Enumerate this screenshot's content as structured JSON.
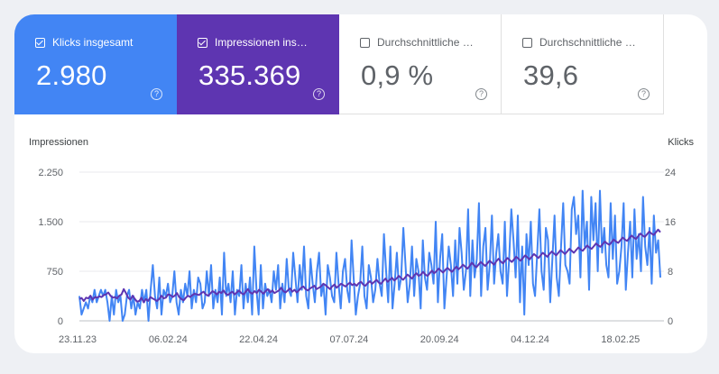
{
  "metrics": [
    {
      "label": "Klicks insgesamt",
      "value": "2.980",
      "checked": true,
      "help": "?"
    },
    {
      "label": "Impressionen ins…",
      "value": "335.369",
      "checked": true,
      "help": "?"
    },
    {
      "label": "Durchschnittliche …",
      "value": "0,9 %",
      "checked": false,
      "help": "?"
    },
    {
      "label": "Durchschnittliche …",
      "value": "39,6",
      "checked": false,
      "help": "?"
    }
  ],
  "colors": {
    "clicks": "#4285f4",
    "impressions": "#5e35b1",
    "grid": "#e8eaed",
    "axis_text": "#5f6368"
  },
  "chart_data": {
    "type": "line",
    "left_axis_label": "Impressionen",
    "right_axis_label": "Klicks",
    "left_ticks": [
      "2.250",
      "1.500",
      "750",
      "0"
    ],
    "right_ticks": [
      "24",
      "16",
      "8",
      "0"
    ],
    "ylim_left": [
      0,
      2250
    ],
    "ylim_right": [
      0,
      24
    ],
    "x_tick_labels": [
      "23.11.23",
      "06.02.24",
      "22.04.24",
      "07.07.24",
      "20.09.24",
      "04.12.24",
      "18.02.25"
    ],
    "series": [
      {
        "name": "Klicks",
        "axis": "right",
        "values": [
          4,
          1,
          2,
          3,
          2,
          4,
          3,
          5,
          3,
          4,
          5,
          4,
          5,
          3,
          0,
          4,
          1,
          5,
          3,
          4,
          0,
          1,
          4,
          5,
          2,
          4,
          1,
          3,
          2,
          5,
          3,
          5,
          0,
          5,
          9,
          4,
          2,
          7,
          1,
          5,
          4,
          6,
          3,
          4,
          8,
          3,
          1,
          5,
          3,
          6,
          4,
          8,
          2,
          5,
          3,
          7,
          6,
          2,
          3,
          8,
          4,
          9,
          2,
          5,
          3,
          7,
          1,
          11,
          4,
          6,
          3,
          8,
          1,
          5,
          4,
          9,
          2,
          6,
          3,
          7,
          1,
          12,
          5,
          1,
          9,
          2,
          6,
          4,
          5,
          3,
          8,
          5,
          9,
          2,
          6,
          3,
          10,
          5,
          4,
          11,
          7,
          3,
          9,
          5,
          12,
          4,
          2,
          10,
          6,
          3,
          8,
          11,
          4,
          6,
          1,
          9,
          7,
          4,
          3,
          11,
          6,
          2,
          8,
          10,
          5,
          3,
          13,
          7,
          1,
          4,
          6,
          12,
          4,
          2,
          9,
          7,
          3,
          5,
          10,
          6,
          4,
          14,
          8,
          3,
          12,
          2,
          6,
          11,
          5,
          7,
          15,
          9,
          3,
          6,
          12,
          4,
          10,
          8,
          2,
          13,
          7,
          5,
          11,
          9,
          6,
          16,
          3,
          10,
          14,
          2,
          7,
          12,
          9,
          4,
          13,
          6,
          15,
          11,
          5,
          8,
          18,
          4,
          13,
          7,
          10,
          19,
          4,
          12,
          15,
          5,
          9,
          17,
          6,
          11,
          14,
          8,
          6,
          16,
          4,
          10,
          18,
          13,
          7,
          17,
          3,
          12,
          1,
          14,
          9,
          16,
          6,
          4,
          11,
          18,
          8,
          5,
          15,
          13,
          3,
          10,
          17,
          7,
          4,
          12,
          19,
          9,
          8,
          6,
          18,
          20,
          14,
          17,
          7,
          21,
          12,
          16,
          5,
          20,
          13,
          19,
          8,
          21,
          11,
          15,
          9,
          7,
          19,
          10,
          17,
          6,
          8,
          12,
          19,
          5,
          11,
          16,
          7,
          18,
          10,
          14,
          8,
          20,
          12,
          9,
          15,
          6,
          17,
          11,
          13,
          7
        ]
      },
      {
        "name": "Impressionen",
        "axis": "left",
        "values": [
          330,
          345,
          300,
          350,
          340,
          380,
          320,
          360,
          350,
          370,
          360,
          390,
          400,
          430,
          380,
          350,
          360,
          340,
          380,
          400,
          480,
          420,
          350,
          320,
          380,
          330,
          290,
          300,
          350,
          280,
          330,
          300,
          360,
          340,
          320,
          300,
          330,
          380,
          340,
          350,
          400,
          390,
          360,
          380,
          420,
          360,
          330,
          310,
          350,
          380,
          360,
          390,
          410,
          400,
          390,
          420,
          440,
          400,
          380,
          410,
          450,
          430,
          400,
          440,
          420,
          460,
          410,
          390,
          420,
          440,
          400,
          430,
          460,
          420,
          400,
          440,
          480,
          430,
          410,
          450,
          420,
          470,
          440,
          410,
          450,
          480,
          430,
          460,
          420,
          440,
          460,
          500,
          450,
          430,
          460,
          490,
          440,
          470,
          430,
          460,
          500,
          520,
          480,
          460,
          490,
          510,
          530,
          480,
          500,
          520,
          560,
          540,
          510,
          480,
          520,
          550,
          500,
          530,
          560,
          540,
          520,
          550,
          580,
          540,
          560,
          530,
          570,
          590,
          550,
          530,
          570,
          600,
          560,
          590,
          620,
          580,
          560,
          600,
          640,
          590,
          620,
          650,
          610,
          640,
          680,
          650,
          620,
          660,
          700,
          670,
          640,
          690,
          720,
          680,
          700,
          740,
          700,
          680,
          720,
          760,
          720,
          750,
          790,
          760,
          730,
          770,
          800,
          770,
          740,
          780,
          820,
          780,
          810,
          850,
          820,
          790,
          830,
          880,
          840,
          810,
          850,
          890,
          860,
          830,
          870,
          910,
          880,
          850,
          900,
          940,
          900,
          870,
          910,
          950,
          920,
          890,
          930,
          970,
          940,
          910,
          950,
          990,
          960,
          930,
          970,
          1010,
          980,
          950,
          990,
          1030,
          1000,
          970,
          1010,
          1050,
          1020,
          990,
          1030,
          1070,
          1040,
          1010,
          1050,
          1090,
          1060,
          1030,
          1070,
          1110,
          1080,
          1060,
          1100,
          1140,
          1110,
          1090,
          1130,
          1170,
          1140,
          1120,
          1160,
          1200,
          1170,
          1150,
          1190,
          1230,
          1200,
          1180,
          1220,
          1260,
          1230,
          1210,
          1250,
          1290,
          1260,
          1240,
          1280,
          1320,
          1290,
          1270,
          1310,
          1350,
          1320,
          1300,
          1340,
          1380,
          1340
        ]
      }
    ]
  }
}
